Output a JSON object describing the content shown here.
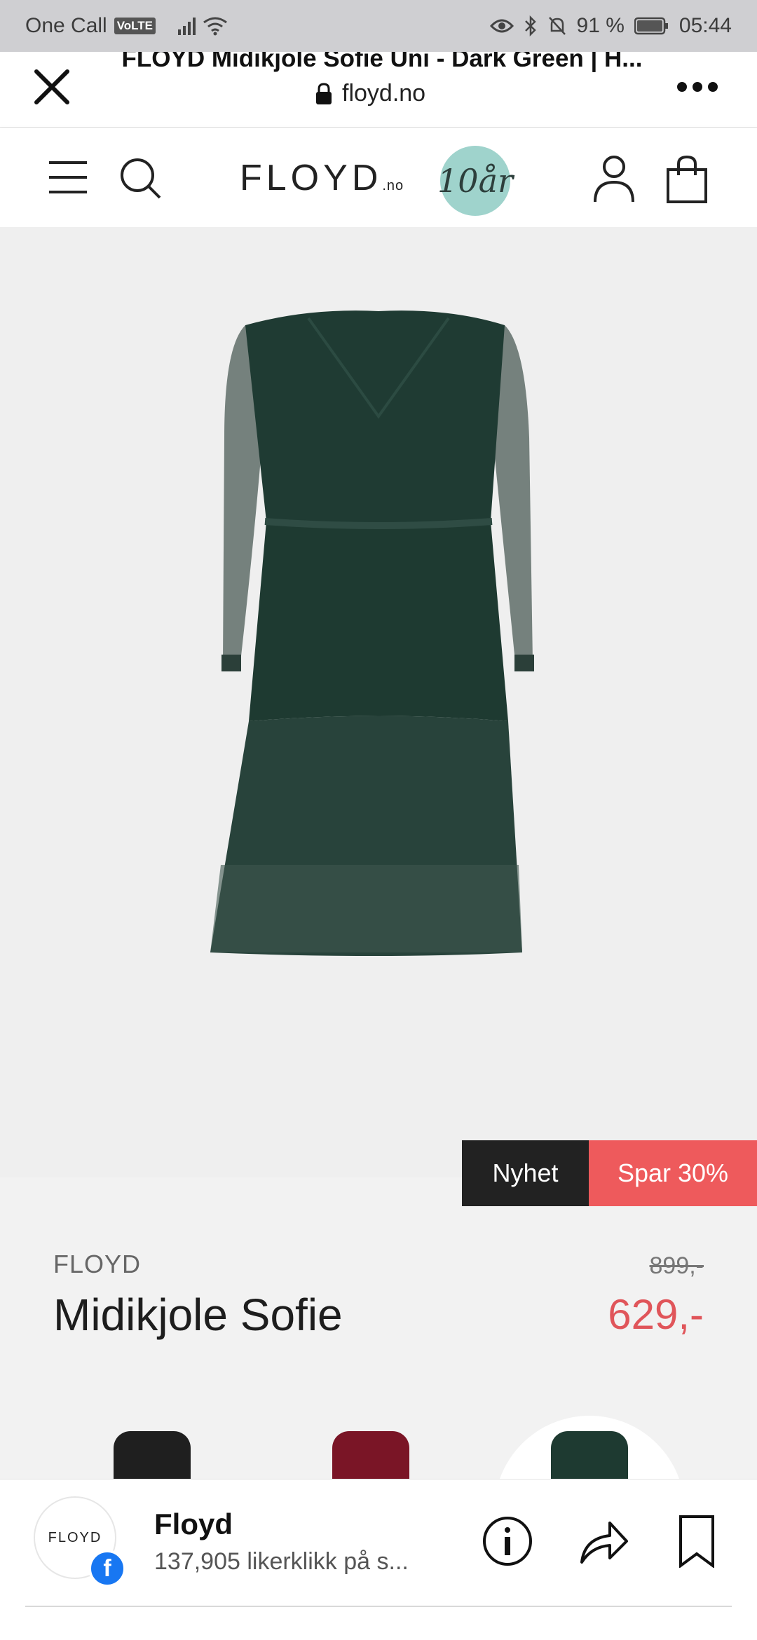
{
  "status_bar": {
    "carrier": "One Call",
    "volte": "VoLTE",
    "battery": "91 %",
    "time": "05:44"
  },
  "browser": {
    "page_title": "FLOYD Midikjole Sofie Uni - Dark Green | H...",
    "url": "floyd.no"
  },
  "site_header": {
    "logo_text": "FLOYD",
    "logo_suffix": ".no",
    "anniversary_badge": "10år"
  },
  "product": {
    "tag_new": "Nyhet",
    "tag_sale": "Spar 30%",
    "brand": "FLOYD",
    "name": "Midikjole Sofie",
    "old_price": "899,-",
    "price": "629,-",
    "swatch_colors": [
      "#1f1f1f",
      "#7a1526",
      "#1e3a31"
    ]
  },
  "facebook_bar": {
    "avatar_text": "FLOYD",
    "page_name": "Floyd",
    "likes_text": "137,905 likerklikk på s..."
  },
  "colors": {
    "accent_sale": "#ee5a5c",
    "price": "#e0555a",
    "dress": "#1e3a31"
  }
}
